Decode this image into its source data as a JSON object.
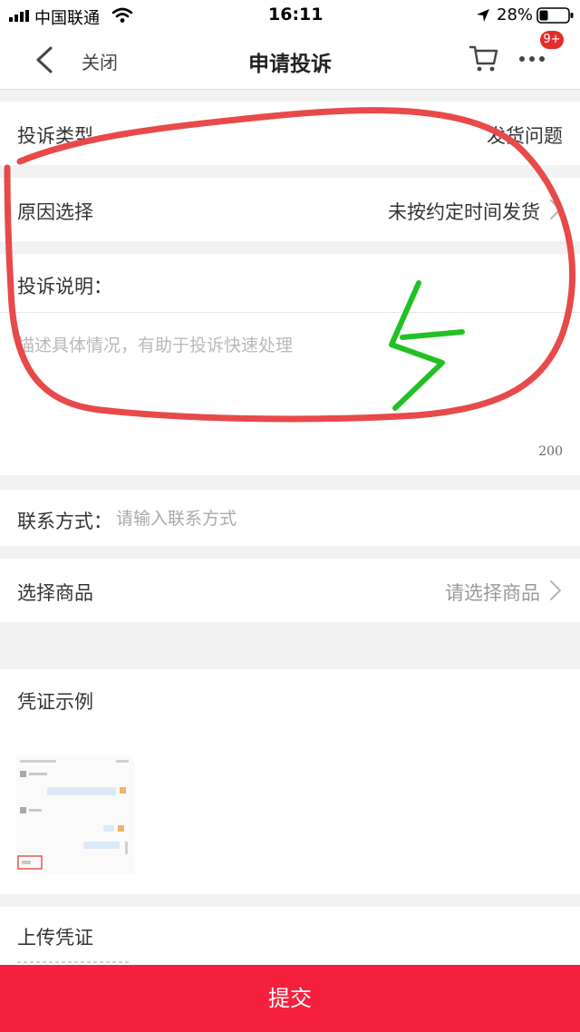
{
  "status_bar": {
    "carrier": "中国联通",
    "time": "16:11",
    "battery": "28%"
  },
  "nav": {
    "back_icon": "chevron-left-icon",
    "close_label": "关闭",
    "title": "申请投诉",
    "cart_icon": "shopping-cart-icon",
    "more_icon": "more-dots-icon",
    "badge": "9+",
    "badge_color": "#e22d2d"
  },
  "form": {
    "complaint_type": {
      "label": "投诉类型",
      "value": "发货问题"
    },
    "reason": {
      "label": "原因选择",
      "value": "未按约定时间发货"
    },
    "description": {
      "label": "投诉说明：",
      "placeholder": "描述具体情况，有助于投诉快速处理",
      "value": "",
      "max_length": "200"
    },
    "contact": {
      "label": "联系方式：",
      "placeholder": "请输入联系方式",
      "value": ""
    },
    "product": {
      "label": "选择商品",
      "value": "请选择商品"
    },
    "voucher_example": {
      "label": "凭证示例"
    },
    "upload": {
      "label": "上传凭证"
    }
  },
  "submit": {
    "label": "提交",
    "color": "#f5203e"
  },
  "annotations": {
    "circle_color": "#e8494a",
    "mark_color": "#22c024"
  }
}
